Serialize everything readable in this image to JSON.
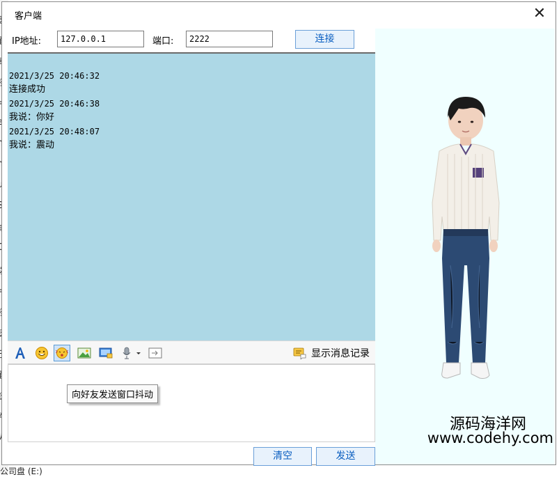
{
  "window": {
    "title": "客户端"
  },
  "connection": {
    "ip_label": "IP地址:",
    "ip_value": "127.0.0.1",
    "port_label": "端口:",
    "port_value": "2222",
    "connect_label": "连接"
  },
  "messages": [
    {
      "time": "2021/3/25 20:46:32",
      "text": "连接成功"
    },
    {
      "time": "2021/3/25 20:46:38",
      "text": "我说：你好"
    },
    {
      "time": "2021/3/25 20:48:07",
      "text": "我说：震动"
    }
  ],
  "toolbar": {
    "tools": [
      "font-icon",
      "emoji-icon",
      "shake-icon",
      "image-icon",
      "screenshot-icon",
      "voice-icon",
      "more-icon"
    ],
    "history_label": "显示消息记录"
  },
  "tooltip": {
    "text": "向好友发送窗口抖动"
  },
  "actions": {
    "clear_label": "清空",
    "send_label": "发送"
  },
  "watermark": {
    "line1": "源码海洋网",
    "line2": "www.codehy.com"
  },
  "desktop": {
    "fragments": [
      "速",
      "面",
      "韩",
      "档",
      "片",
      "es",
      "ng",
      "ng",
      "ut",
      "S",
      "电",
      "O",
      "拨",
      "片",
      "档",
      "铸",
      "乐",
      "面",
      "统",
      "件",
      "人"
    ],
    "taskbar": "公司盘 (E:)"
  },
  "colors": {
    "chat_bg": "#add8e6",
    "panel_bg": "#f0ffff",
    "button_text": "#0a5ec0",
    "button_border": "#6a9fd8"
  }
}
